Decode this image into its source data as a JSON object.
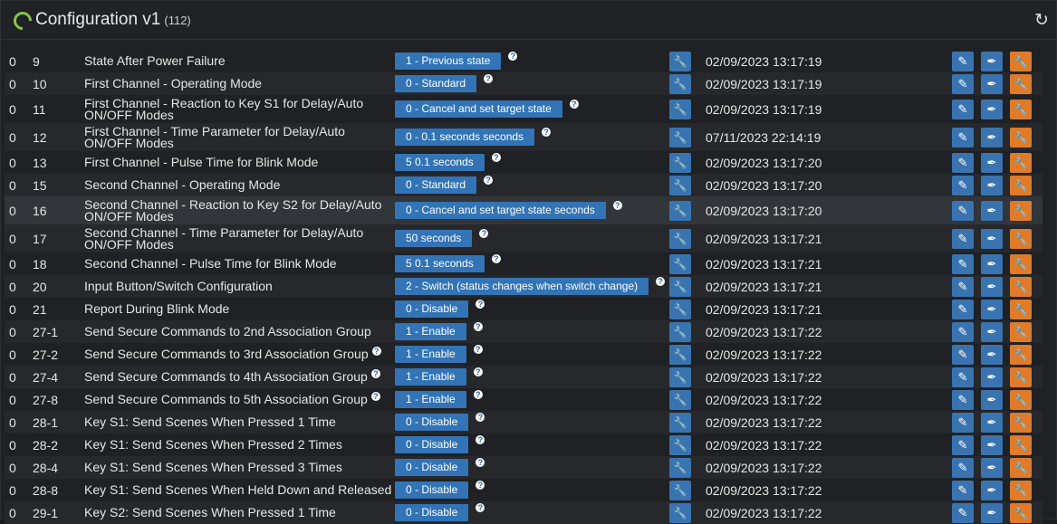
{
  "header": {
    "title": "Configuration v1",
    "count": "(112)",
    "refresh_icon": "refresh-icon"
  },
  "rows": [
    {
      "node": "0",
      "index": "9",
      "name": "State After Power Failure",
      "value": "1 - Previous state",
      "date": "02/09/2023 13:17:19"
    },
    {
      "node": "0",
      "index": "10",
      "name": "First Channel - Operating Mode",
      "value": "0 - Standard",
      "date": "02/09/2023 13:17:19"
    },
    {
      "node": "0",
      "index": "11",
      "name": "First Channel - Reaction to Key S1 for Delay/Auto ON/OFF Modes",
      "value": "0 - Cancel and set target state",
      "date": "02/09/2023 13:17:19"
    },
    {
      "node": "0",
      "index": "12",
      "name": "First Channel - Time Parameter for Delay/Auto ON/OFF Modes",
      "value": "0 - 0.1 seconds seconds",
      "date": "07/11/2023 22:14:19"
    },
    {
      "node": "0",
      "index": "13",
      "name": "First Channel - Pulse Time for Blink Mode",
      "value": "5 0.1 seconds",
      "date": "02/09/2023 13:17:20"
    },
    {
      "node": "0",
      "index": "15",
      "name": "Second Channel - Operating Mode",
      "value": "0 - Standard",
      "date": "02/09/2023 13:17:20"
    },
    {
      "node": "0",
      "index": "16",
      "name": "Second Channel - Reaction to Key S2 for Delay/Auto ON/OFF Modes",
      "value": "0 - Cancel and set target state seconds",
      "date": "02/09/2023 13:17:20"
    },
    {
      "node": "0",
      "index": "17",
      "name": "Second Channel - Time Parameter for Delay/Auto ON/OFF Modes",
      "value": "50 seconds",
      "date": "02/09/2023 13:17:21"
    },
    {
      "node": "0",
      "index": "18",
      "name": "Second Channel - Pulse Time for Blink Mode",
      "value": "5 0.1 seconds",
      "date": "02/09/2023 13:17:21"
    },
    {
      "node": "0",
      "index": "20",
      "name": "Input Button/Switch Configuration",
      "value": "2 - Switch (status changes when switch change)",
      "date": "02/09/2023 13:17:21"
    },
    {
      "node": "0",
      "index": "21",
      "name": "Report During Blink Mode",
      "value": "0 - Disable",
      "date": "02/09/2023 13:17:21"
    },
    {
      "node": "0",
      "index": "27-1",
      "name": "Send Secure Commands to 2nd Association Group",
      "value": "1 - Enable",
      "date": "02/09/2023 13:17:22"
    },
    {
      "node": "0",
      "index": "27-2",
      "name": "Send Secure Commands to 3rd Association Group",
      "value": "1 - Enable",
      "date": "02/09/2023 13:17:22"
    },
    {
      "node": "0",
      "index": "27-4",
      "name": "Send Secure Commands to 4th Association Group",
      "value": "1 - Enable",
      "date": "02/09/2023 13:17:22"
    },
    {
      "node": "0",
      "index": "27-8",
      "name": "Send Secure Commands to 5th Association Group",
      "value": "1 - Enable",
      "date": "02/09/2023 13:17:22"
    },
    {
      "node": "0",
      "index": "28-1",
      "name": "Key S1: Send Scenes When Pressed 1 Time",
      "value": "0 - Disable",
      "date": "02/09/2023 13:17:22"
    },
    {
      "node": "0",
      "index": "28-2",
      "name": "Key S1: Send Scenes When Pressed 2 Times",
      "value": "0 - Disable",
      "date": "02/09/2023 13:17:22"
    },
    {
      "node": "0",
      "index": "28-4",
      "name": "Key S1: Send Scenes When Pressed 3 Times",
      "value": "0 - Disable",
      "date": "02/09/2023 13:17:22"
    },
    {
      "node": "0",
      "index": "28-8",
      "name": "Key S1: Send Scenes When Held Down and Released",
      "value": "0 - Disable",
      "date": "02/09/2023 13:17:22"
    },
    {
      "node": "0",
      "index": "29-1",
      "name": "Key S2: Send Scenes When Pressed 1 Time",
      "value": "0 - Disable",
      "date": "02/09/2023 13:17:22"
    }
  ],
  "icons": {
    "help": "question-icon",
    "wrench": "wrench-icon",
    "edit": "pencil-icon",
    "picker": "eyedropper-icon",
    "settings": "wrench-icon"
  }
}
